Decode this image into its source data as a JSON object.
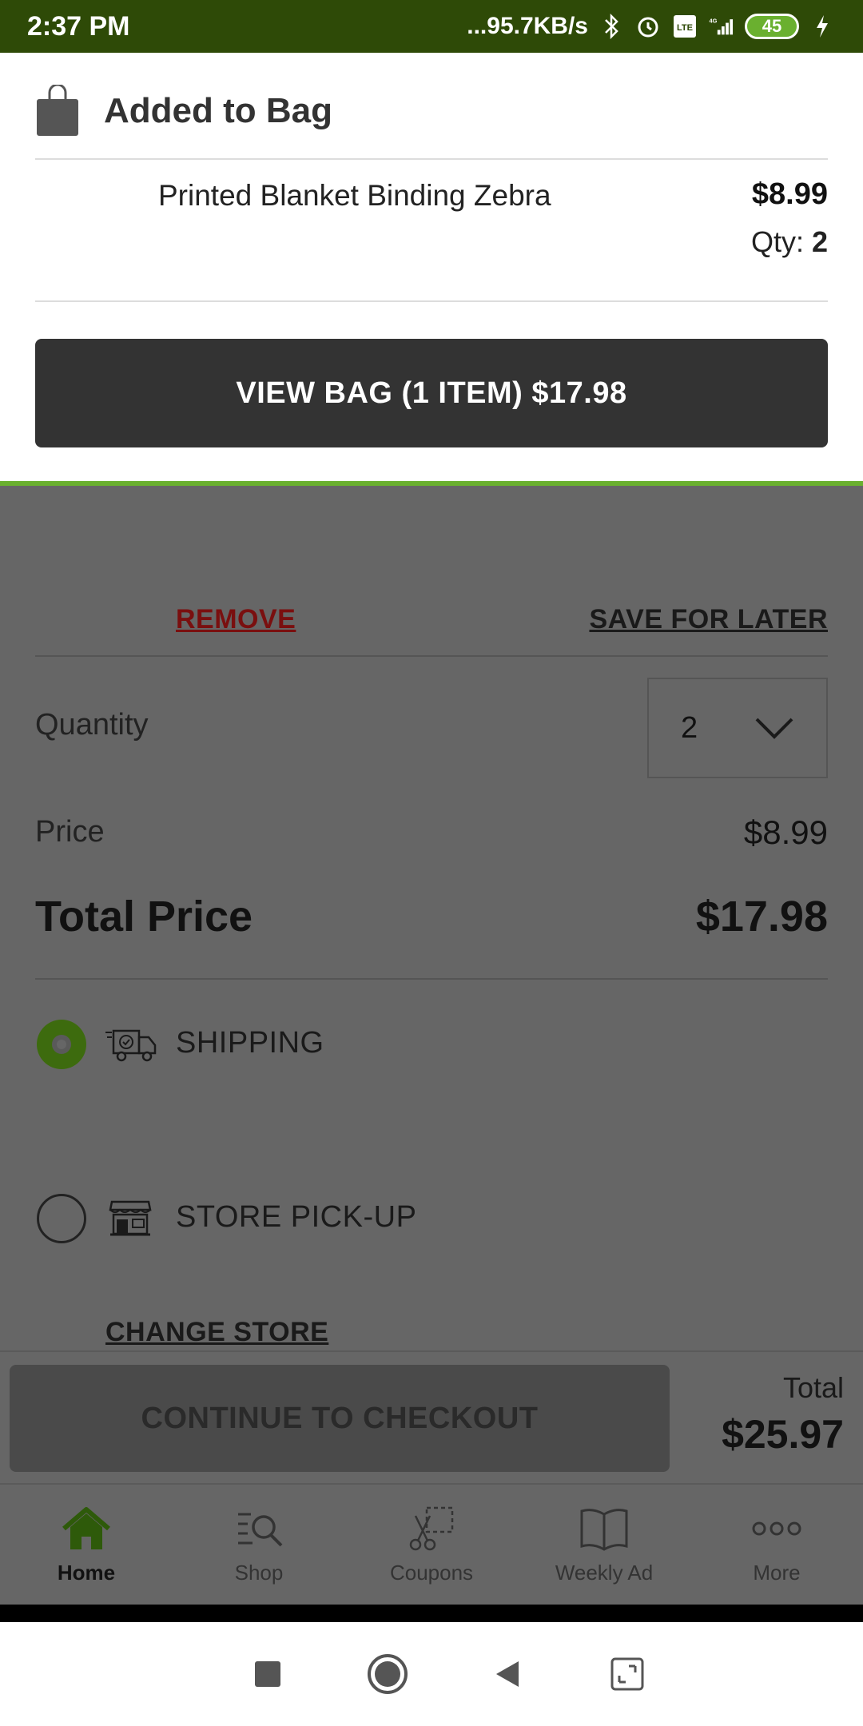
{
  "status_bar": {
    "time": "2:37 PM",
    "network_speed": "...95.7KB/s",
    "battery": "45",
    "signal": "4G"
  },
  "added_to_bag": {
    "title": "Added to Bag",
    "item_name": "Printed Blanket Binding Zebra",
    "item_price": "$8.99",
    "qty_label": "Qty:",
    "qty_value": "2",
    "view_bag_button": "VIEW BAG (1 ITEM) $17.98"
  },
  "cart": {
    "remove_link": "REMOVE",
    "save_for_later_link": "SAVE FOR LATER",
    "quantity_label": "Quantity",
    "quantity_value": "2",
    "price_label": "Price",
    "price_value": "$8.99",
    "total_price_label": "Total Price",
    "total_price_value": "$17.98",
    "shipping_label": "SHIPPING",
    "store_pickup_label": "STORE PICK-UP",
    "change_store_link": "CHANGE STORE",
    "shipping_selected": true
  },
  "checkout": {
    "button_label": "CONTINUE TO CHECKOUT",
    "total_label": "Total",
    "total_value": "$25.97"
  },
  "bottom_nav": {
    "items": [
      {
        "label": "Home",
        "icon": "home-icon",
        "active": true
      },
      {
        "label": "Shop",
        "icon": "shop-search-icon",
        "active": false
      },
      {
        "label": "Coupons",
        "icon": "coupon-scissors-icon",
        "active": false
      },
      {
        "label": "Weekly Ad",
        "icon": "book-icon",
        "active": false
      },
      {
        "label": "More",
        "icon": "more-dots-icon",
        "active": false
      }
    ]
  },
  "colors": {
    "status_bar": "#2e4a07",
    "accent_green": "#6ab02f",
    "remove_red": "#7a0f0f",
    "overlay_gray": "#666666",
    "view_bag_button": "#333333"
  }
}
